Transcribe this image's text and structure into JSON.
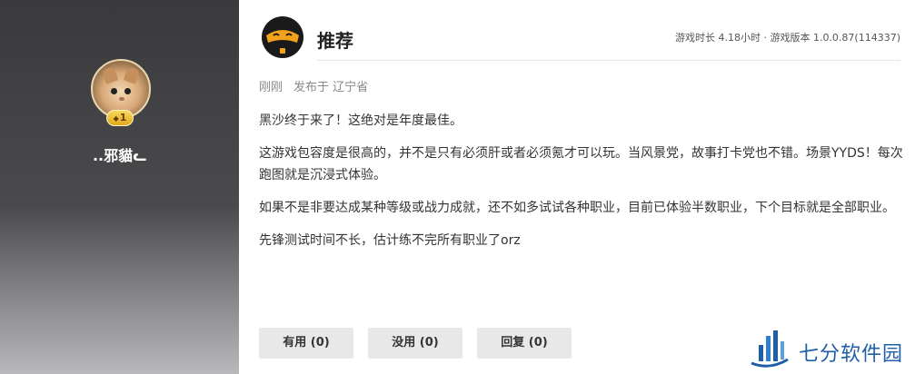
{
  "user": {
    "name": "..邪貓ᓚ",
    "level": "1"
  },
  "review": {
    "recommend_label": "推荐",
    "meta": "游戏时长 4.18小时 · 游戏版本 1.0.0.87(114337)",
    "posted_time": "刚刚",
    "posted_location": "发布于 辽宁省",
    "paragraphs": [
      "黑沙终于来了！这绝对是年度最佳。",
      "这游戏包容度是很高的，并不是只有必须肝或者必须氪才可以玩。当风景党，故事打卡党也不错。场景YYDS！每次跑图就是沉浸式体验。",
      "如果不是非要达成某种等级或战力成就，还不如多试试各种职业，目前已体验半数职业，下个目标就是全部职业。",
      "先锋测试时间不长，估计练不完所有职业了orz"
    ]
  },
  "actions": {
    "useful": "有用 (0)",
    "useless": "没用 (0)",
    "reply": "回复 (0)"
  },
  "watermark": {
    "text": "七分软件园"
  },
  "colors": {
    "left_panel": "#3a3a3c",
    "accent_orange": "#f2a21c",
    "watermark_blue": "#1f5fa8",
    "button_bg": "#e8e8e8"
  }
}
